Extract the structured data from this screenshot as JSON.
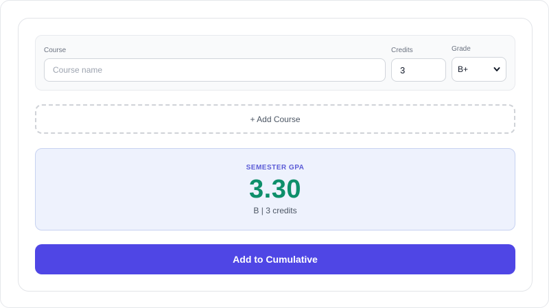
{
  "course_row": {
    "course_label": "Course",
    "course_placeholder": "Course name",
    "course_value": "",
    "credits_label": "Credits",
    "credits_value": "3",
    "grade_label": "Grade",
    "grade_value": "B+"
  },
  "add_course_label": "+ Add Course",
  "gpa": {
    "label": "SEMESTER GPA",
    "value": "3.30",
    "summary": "B | 3 credits"
  },
  "cumulative_button_label": "Add to Cumulative",
  "colors": {
    "accent": "#4f46e5",
    "gpa_value": "#0e8f6a",
    "gpa_panel_bg": "#eef2fd"
  }
}
